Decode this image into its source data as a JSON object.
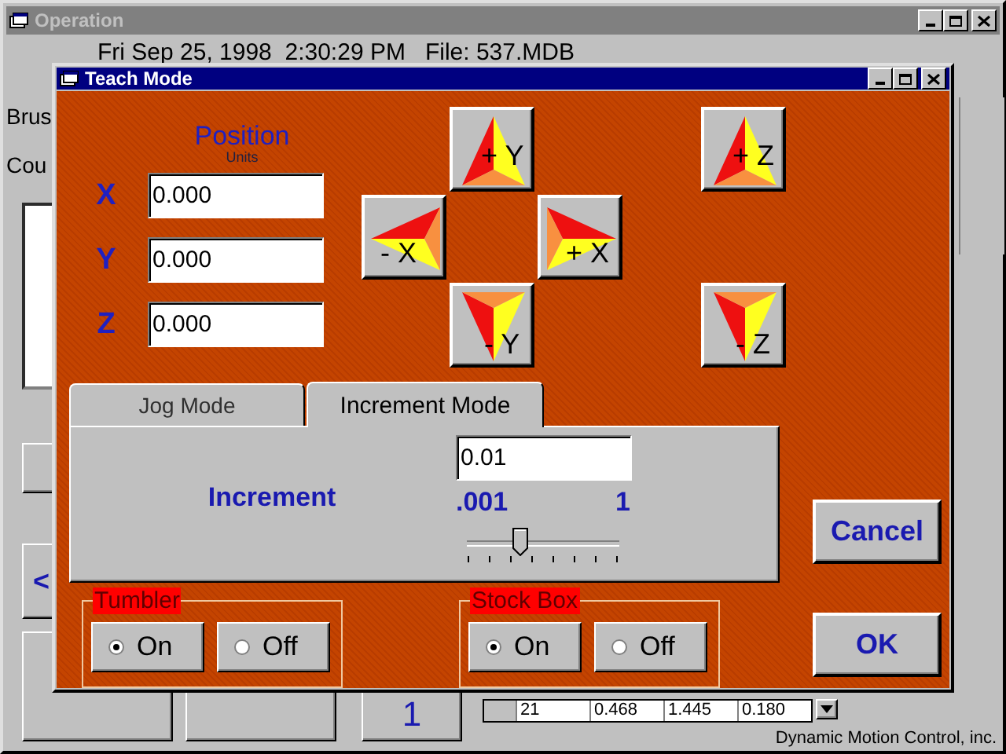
{
  "operation_window": {
    "title": "Operation",
    "header": "Fri Sep 25, 1998  2:30:29 PM   File: 537.MDB",
    "labels": [
      "Brus",
      "Cou"
    ],
    "side_button": "<",
    "bottom_button": "1",
    "table_row": [
      "21",
      "0.468",
      "1.445",
      "0.180"
    ],
    "footer": "Dynamic Motion Control, inc."
  },
  "teach_mode": {
    "title": "Teach Mode",
    "position": {
      "title": "Position",
      "units": "Units",
      "axes": [
        {
          "label": "X",
          "value": "0.000"
        },
        {
          "label": "Y",
          "value": "0.000"
        },
        {
          "label": "Z",
          "value": "0.000"
        }
      ]
    },
    "jog_buttons": [
      {
        "label": "+ Y",
        "kind": "up"
      },
      {
        "label": "- X",
        "kind": "left"
      },
      {
        "label": "+ X",
        "kind": "right"
      },
      {
        "label": "- Y",
        "kind": "down"
      },
      {
        "label": "+ Z",
        "kind": "up"
      },
      {
        "label": "- Z",
        "kind": "down"
      }
    ],
    "tabs": [
      {
        "label": "Jog Mode",
        "selected": false
      },
      {
        "label": "Increment Mode",
        "selected": true
      }
    ],
    "increment": {
      "label": "Increment",
      "value": "0.01",
      "min_label": ".001",
      "max_label": "1",
      "level": 0.35
    },
    "groups": [
      {
        "title": "Tumbler",
        "options": [
          {
            "label": "On",
            "selected": true
          },
          {
            "label": "Off",
            "selected": false
          }
        ]
      },
      {
        "title": "Stock Box",
        "options": [
          {
            "label": "On",
            "selected": true
          },
          {
            "label": "Off",
            "selected": false
          }
        ]
      }
    ],
    "buttons": [
      "Cancel",
      "OK"
    ]
  }
}
